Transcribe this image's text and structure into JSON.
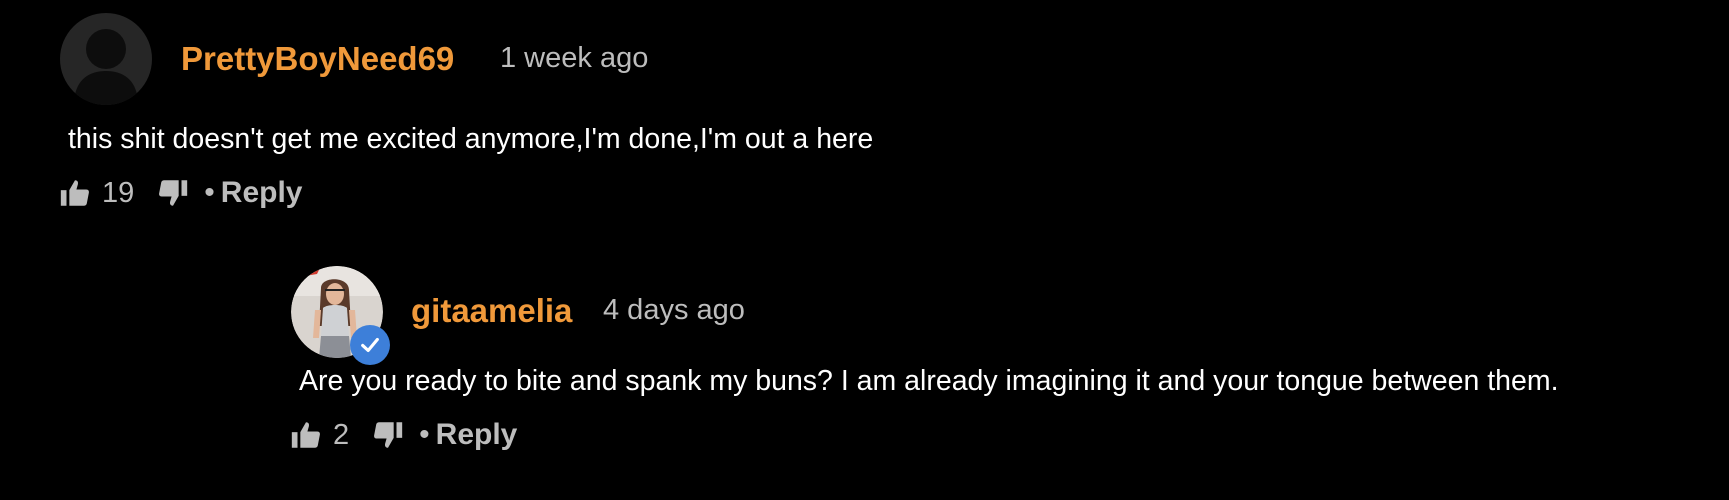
{
  "comments": [
    {
      "username": "PrettyBoyNeed69",
      "timestamp": "1 week ago",
      "text": "this shit doesn't get me excited anymore,I'm done,I'm out a here",
      "likes": "19",
      "reply_label": "Reply",
      "avatar": "default-user-silhouette",
      "verified": false
    },
    {
      "username": "gitaamelia",
      "timestamp": "4 days ago",
      "text": "Are you ready to bite and spank my buns? I am already imagining it and your tongue between them.",
      "likes": "2",
      "reply_label": "Reply",
      "avatar": "user-photo",
      "verified": true
    }
  ],
  "separator": "•",
  "icons": {
    "like": "thumbs-up-icon",
    "dislike": "thumbs-down-icon",
    "verified": "check-icon"
  },
  "colors": {
    "background": "#000000",
    "username": "#f0993a",
    "meta": "#bdbdbd",
    "text": "#ffffff",
    "verified_badge": "#3d7fd9"
  }
}
